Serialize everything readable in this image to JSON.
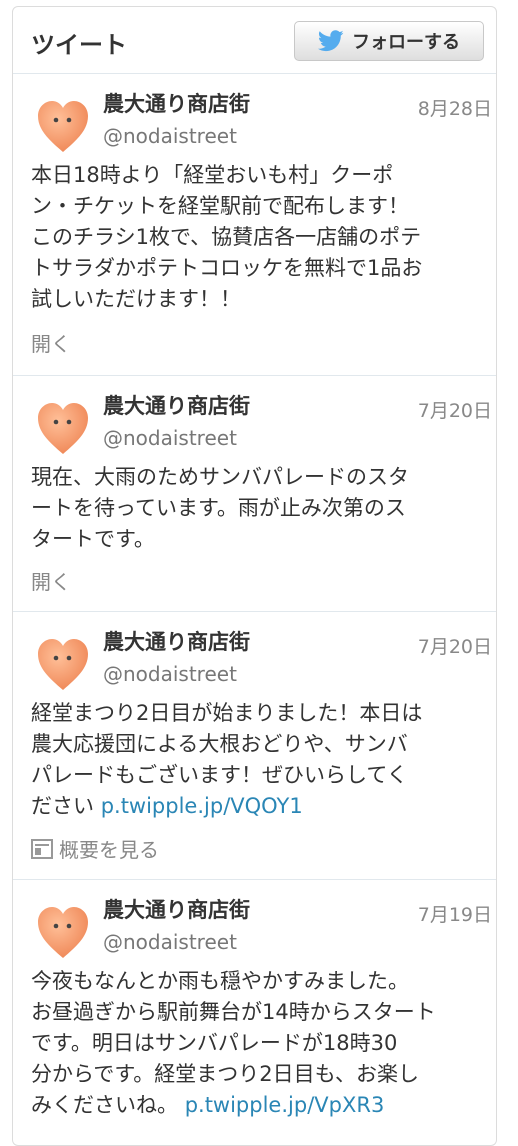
{
  "header": {
    "title": "ツイート",
    "follow_label": "フォローする",
    "follow_icon": "twitter-bird-icon",
    "accent_color": "#55acee"
  },
  "tweets": [
    {
      "name": "農大通り商店街",
      "handle": "@nodaistreet",
      "date": "8月28日",
      "lines": [
        "本日18時より「経堂おいも村」クーポ",
        "ン・チケットを経堂駅前で配布します！",
        "このチラシ1枚で、協賛店各一店舗のポテ",
        "トサラダかポテトコロッケを無料で1品お",
        "試しいただけます！！"
      ],
      "link": "",
      "action": "開く"
    },
    {
      "name": "農大通り商店街",
      "handle": "@nodaistreet",
      "date": "7月20日",
      "lines": [
        "現在、大雨のためサンバパレードのスタ",
        "ートを待っています。雨が止み次第のス",
        "タートです。"
      ],
      "link": "",
      "action": "開く"
    },
    {
      "name": "農大通り商店街",
      "handle": "@nodaistreet",
      "date": "7月20日",
      "lines": [
        "経堂まつり2日目が始まりました！本日は",
        "農大応援団による大根おどりや、サンバ",
        "パレードもございます！ぜひいらしてく",
        "ださい "
      ],
      "link": "p.twipple.jp/VQOY1",
      "action": "概要を見る"
    },
    {
      "name": "農大通り商店街",
      "handle": "@nodaistreet",
      "date": "7月19日",
      "lines": [
        "今夜もなんとか雨も穏やかすみました。",
        "お昼過ぎから駅前舞台が14時からスタート",
        "です。明日はサンバパレードが18時30",
        "分からです。経堂まつり2日目も、お楽し",
        "みくださいね。 "
      ],
      "link": "p.twipple.jp/VpXR3",
      "action": ""
    }
  ]
}
